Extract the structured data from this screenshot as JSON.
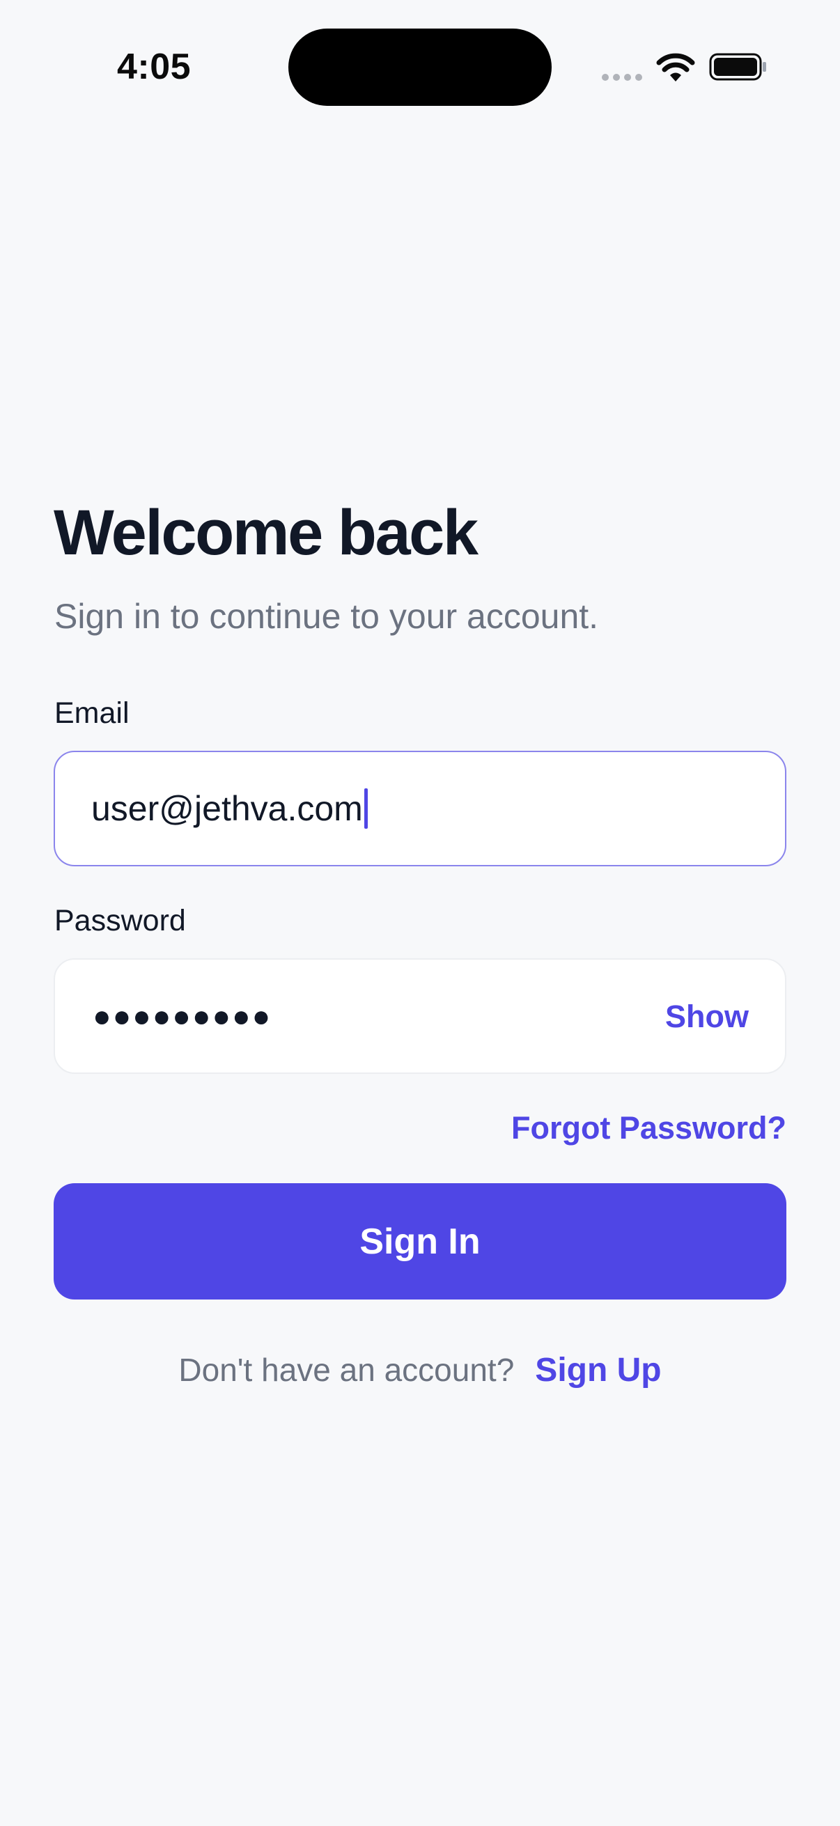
{
  "status_bar": {
    "time": "4:05"
  },
  "login": {
    "title": "Welcome back",
    "subtitle": "Sign in to continue to your account.",
    "email": {
      "label": "Email",
      "value": "user@jethva.com"
    },
    "password": {
      "label": "Password",
      "masked_value": "●●●●●●●●●",
      "show_label": "Show"
    },
    "forgot_password_label": "Forgot Password?",
    "sign_in_label": "Sign In",
    "signup_prompt": "Don't have an account?",
    "signup_link": "Sign Up"
  },
  "colors": {
    "accent": "#4F46E5",
    "background": "#F7F8FA",
    "text_primary": "#111827",
    "text_secondary": "#6B7280"
  },
  "icons": [
    "signal-icon",
    "wifi-icon",
    "battery-icon"
  ]
}
